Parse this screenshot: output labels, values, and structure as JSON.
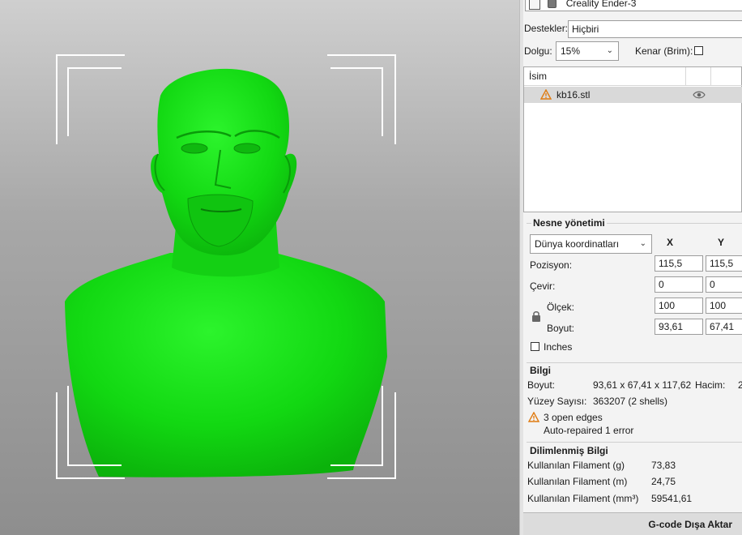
{
  "printer": {
    "name": "Creality Ender-3"
  },
  "settings": {
    "supports_label": "Destekler:",
    "supports_value": "Hiçbiri",
    "infill_label": "Dolgu:",
    "infill_value": "15%",
    "brim_label": "Kenar (Brim):"
  },
  "object_list": {
    "column_name": "İsim",
    "items": [
      {
        "name": "kb16.stl"
      }
    ]
  },
  "object_manipulation": {
    "title": "Nesne yönetimi",
    "coord_system": "Dünya koordinatları",
    "col_x": "X",
    "col_y": "Y",
    "position_label": "Pozisyon:",
    "rotate_label": "Çevir:",
    "scale_label": "Ölçek:",
    "size_label": "Boyut:",
    "inches_label": "Inches",
    "position": {
      "x": "115,5",
      "y": "115,5"
    },
    "rotate": {
      "x": "0",
      "y": "0"
    },
    "scale": {
      "x": "100",
      "y": "100"
    },
    "size": {
      "x": "93,61",
      "y": "67,41"
    }
  },
  "info": {
    "title": "Bilgi",
    "size_label": "Boyut:",
    "size_value": "93,61 x 67,41 x 117,62",
    "volume_label": "Hacim:",
    "volume_value": "2",
    "facets_label": "Yüzey Sayısı:",
    "facets_value": "363207 (2 shells)",
    "warning_line1": "3 open edges",
    "warning_line2": "Auto-repaired 1 error"
  },
  "sliced_info": {
    "title": "Dilimlenmiş Bilgi",
    "filament_g_label": "Kullanılan Filament (g)",
    "filament_g_value": "73,83",
    "filament_m_label": "Kullanılan Filament (m)",
    "filament_m_value": "24,75",
    "filament_mm3_label": "Kullanılan Filament (mm³)",
    "filament_mm3_value": "59541,61"
  },
  "export_button": "G-code Dışa Aktar",
  "colors": {
    "model": "#18d818",
    "accent": "#f29d1a"
  }
}
